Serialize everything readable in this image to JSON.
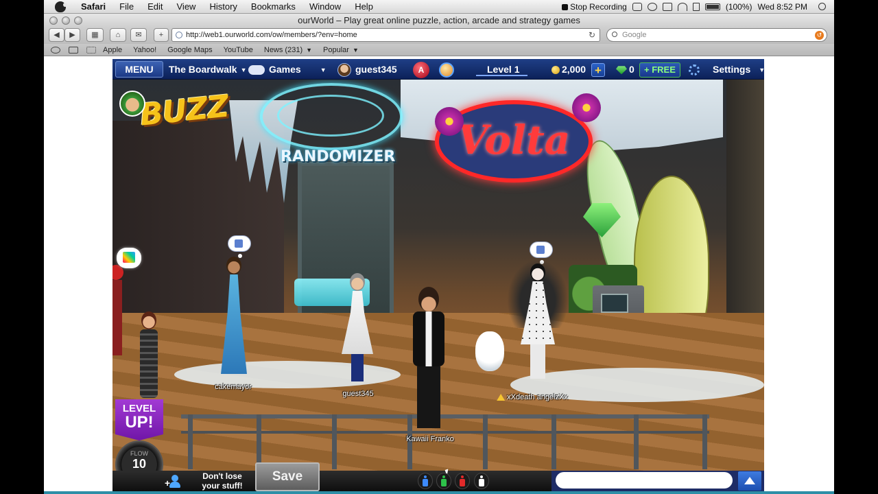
{
  "menubar": {
    "app_name": "Safari",
    "menus": [
      "File",
      "Edit",
      "View",
      "History",
      "Bookmarks",
      "Window",
      "Help"
    ],
    "stop_recording": "Stop Recording",
    "battery": "(100%)",
    "clock": "Wed 8:52 PM"
  },
  "browser": {
    "window_title": "ourWorld – Play great online puzzle, action, arcade and strategy games",
    "url": "http://web1.ourworld.com/ow/members/?env=home",
    "search_placeholder": "Google",
    "bookmarks": [
      "Apple",
      "Yahoo!",
      "Google Maps",
      "YouTube",
      "News (231)",
      "Popular"
    ]
  },
  "game_topbar": {
    "menu_label": "MENU",
    "location": "The Boardwalk",
    "games_label": "Games",
    "username": "guest345",
    "level_label": "Level 1",
    "level_progress": 0,
    "coins": "2,000",
    "gems": "0",
    "free_label": "FREE",
    "settings_label": "Settings"
  },
  "scene": {
    "signs": {
      "buzz": "BUZZ",
      "randomizer": "RANDOMIZER",
      "volta": "Volta"
    },
    "players": [
      {
        "name": "cakemayor"
      },
      {
        "name": "guest345"
      },
      {
        "name": "Kawaii Franko"
      },
      {
        "name": "xXdeath angelzXx"
      }
    ],
    "level_up": {
      "line1": "LEVEL",
      "line2": "UP!"
    },
    "flow": {
      "label": "FLOW",
      "value": "10"
    }
  },
  "game_bottombar": {
    "dont_lose_line1": "Don't lose",
    "dont_lose_line2": "your stuff!",
    "save_label": "Save",
    "emote_colors": [
      "#3d8bff",
      "#2ec24a",
      "#e22a2a",
      "#ffffff"
    ],
    "chat_placeholder": ""
  },
  "colors": {
    "game_bar_blue": "#0c2159",
    "level_up_purple": "#8b27c4",
    "free_green": "#8bff7e",
    "volta_red": "#ff2828"
  }
}
